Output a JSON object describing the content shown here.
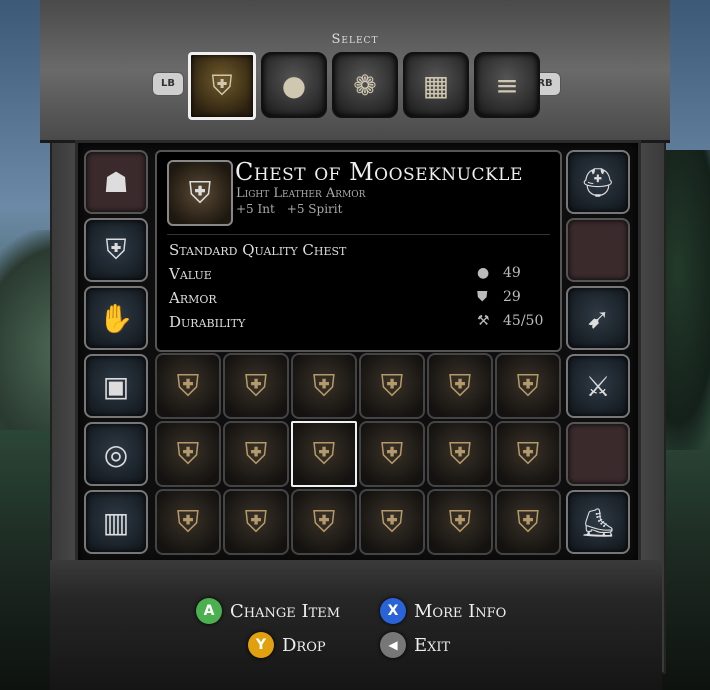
{
  "header": {
    "select_label": "Select"
  },
  "bumpers": {
    "left": "LB",
    "right": "RB"
  },
  "tabs": [
    {
      "icon": "shield-sword-icon",
      "glyph": "⛨",
      "active": true
    },
    {
      "icon": "bag-icon",
      "glyph": "●",
      "active": false
    },
    {
      "icon": "scroll-icon",
      "glyph": "❁",
      "active": false
    },
    {
      "icon": "book-icon",
      "glyph": "▦",
      "active": false
    },
    {
      "icon": "list-icon",
      "glyph": "≡",
      "active": false
    }
  ],
  "item": {
    "name": "Chest of Mooseknuckle",
    "type": "Light Leather Armor",
    "bonus1": "+5 Int",
    "bonus2": "+5 Spirit",
    "quality": "Standard Quality Chest",
    "stats": [
      {
        "label": "Value",
        "icon": "coin-icon",
        "glyph": "●",
        "value": "49"
      },
      {
        "label": "Armor",
        "icon": "shield-icon",
        "glyph": "⛊",
        "value": "29"
      },
      {
        "label": "Durability",
        "icon": "hammer-icon",
        "glyph": "⚒",
        "value": "45/50"
      }
    ]
  },
  "left_slots": [
    {
      "name": "shoulders-slot",
      "glyph": "☗",
      "empty": true
    },
    {
      "name": "chest-slot",
      "glyph": "⛨",
      "empty": false
    },
    {
      "name": "gloves-slot",
      "glyph": "✋",
      "empty": false
    },
    {
      "name": "bracer-slot",
      "glyph": "▣",
      "empty": false
    },
    {
      "name": "ring-slot",
      "glyph": "◎",
      "empty": false
    },
    {
      "name": "legs-slot",
      "glyph": "▥",
      "empty": false
    }
  ],
  "right_slots": [
    {
      "name": "helmet-slot",
      "glyph": "⛑",
      "empty": false
    },
    {
      "name": "empty-slot-1",
      "glyph": "",
      "empty": true
    },
    {
      "name": "bow-slot",
      "glyph": "➹",
      "empty": false
    },
    {
      "name": "axe-slot",
      "glyph": "⚔",
      "empty": false
    },
    {
      "name": "empty-slot-2",
      "glyph": "",
      "empty": true
    },
    {
      "name": "boots-slot",
      "glyph": "⛸",
      "empty": false
    }
  ],
  "armor_grid": [
    {
      "glyph": "⛨"
    },
    {
      "glyph": "⛨"
    },
    {
      "glyph": "⛨"
    },
    {
      "glyph": "⛨"
    },
    {
      "glyph": "⛨"
    },
    {
      "glyph": "⛨"
    },
    {
      "glyph": "⛨"
    },
    {
      "glyph": "⛨"
    },
    {
      "glyph": "⛨",
      "selected": true
    },
    {
      "glyph": "⛨"
    },
    {
      "glyph": "⛨"
    },
    {
      "glyph": "⛨"
    },
    {
      "glyph": "⛨"
    },
    {
      "glyph": "⛨"
    },
    {
      "glyph": "⛨"
    },
    {
      "glyph": "⛨"
    },
    {
      "glyph": "⛨"
    },
    {
      "glyph": "⛨"
    }
  ],
  "hints": [
    {
      "button": "A",
      "label": "Change Item",
      "color": "#4caf50"
    },
    {
      "button": "X",
      "label": "More Info",
      "color": "#2a62d8"
    },
    {
      "button": "Y",
      "label": "Drop",
      "color": "#e0a010"
    },
    {
      "button": "◀",
      "label": "Exit",
      "color": "#777777"
    }
  ]
}
